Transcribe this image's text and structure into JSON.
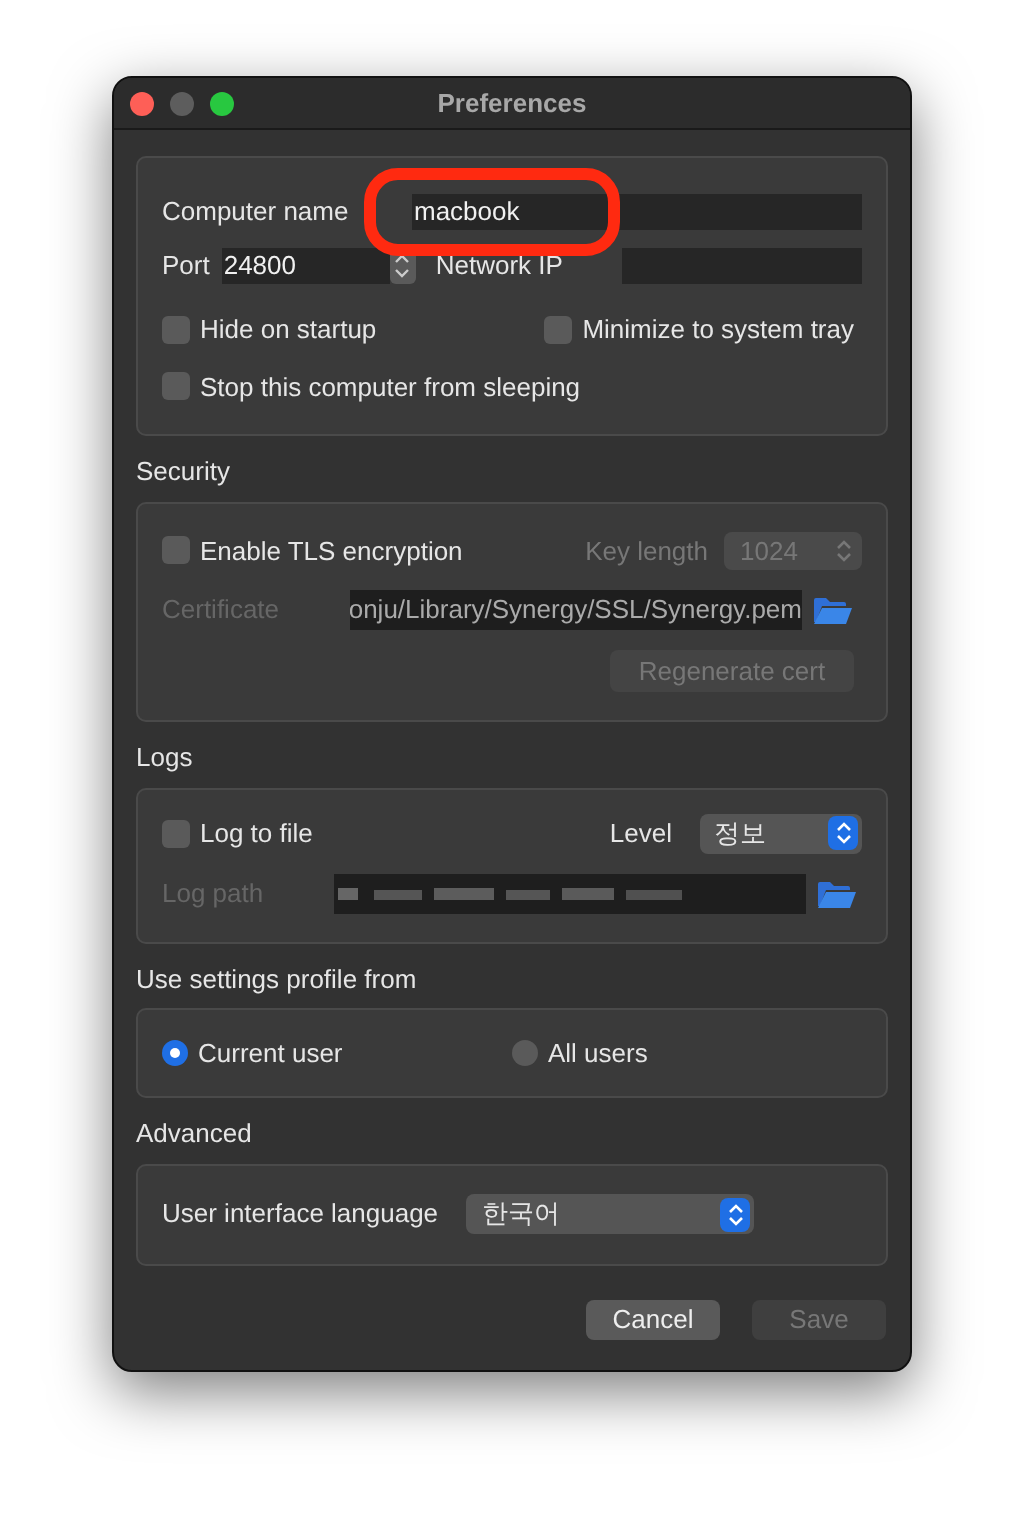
{
  "window": {
    "title": "Preferences"
  },
  "general": {
    "computer_name": {
      "label": "Computer name",
      "value": "macbook"
    },
    "port": {
      "label": "Port",
      "value": "24800"
    },
    "network_ip": {
      "label": "Network IP"
    },
    "checkboxes": [
      {
        "label": "Hide on startup",
        "checked": false
      },
      {
        "label": "Minimize to system tray",
        "checked": false
      },
      {
        "label": "Stop this computer from sleeping",
        "checked": false
      }
    ]
  },
  "security": {
    "heading": "Security",
    "tls": {
      "label": "Enable TLS encryption",
      "checked": false
    },
    "key_length": {
      "label": "Key length",
      "value": "1024",
      "disabled": true
    },
    "certificate": {
      "label": "Certificate",
      "value": "onju/Library/Synergy/SSL/Synergy.pem",
      "disabled": true
    },
    "regenerate": {
      "label": "Regenerate cert",
      "disabled": true
    }
  },
  "logs": {
    "heading": "Logs",
    "log_to_file": {
      "label": "Log to file",
      "checked": false
    },
    "level": {
      "label": "Level",
      "value": "정보"
    },
    "log_path": {
      "label": "Log path",
      "disabled": true
    }
  },
  "profile": {
    "heading": "Use settings profile from",
    "options": [
      {
        "label": "Current user",
        "selected": true
      },
      {
        "label": "All users",
        "selected": false
      }
    ]
  },
  "advanced": {
    "heading": "Advanced",
    "language": {
      "label": "User interface language",
      "value": "한국어"
    }
  },
  "buttons": [
    {
      "label": "Cancel",
      "disabled": false
    },
    {
      "label": "Save",
      "disabled": true
    }
  ]
}
